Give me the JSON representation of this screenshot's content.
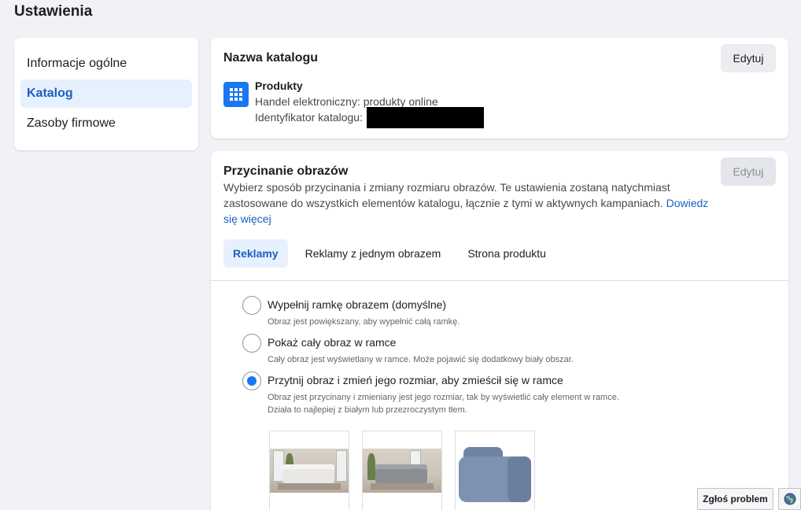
{
  "page": {
    "title": "Ustawienia"
  },
  "sidebar": {
    "items": [
      {
        "label": "Informacje ogólne"
      },
      {
        "label": "Katalog"
      },
      {
        "label": "Zasoby firmowe"
      }
    ]
  },
  "catalog_card": {
    "title": "Nazwa katalogu",
    "edit_label": "Edytuj",
    "catalog_name": "Produkty",
    "catalog_type": "Handel elektroniczny: produkty online",
    "catalog_id_label": "Identyfikator katalogu:"
  },
  "crop_card": {
    "title": "Przycinanie obrazów",
    "edit_label": "Edytuj",
    "description": "Wybierz sposób przycinania i zmiany rozmiaru obrazów. Te ustawienia zostaną natychmiast zastosowane do wszystkich elementów katalogu, łącznie z tymi w aktywnych kampaniach.",
    "learn_more": "Dowiedz się więcej",
    "tabs": [
      {
        "label": "Reklamy"
      },
      {
        "label": "Reklamy z jednym obrazem"
      },
      {
        "label": "Strona produktu"
      }
    ],
    "options": [
      {
        "label": "Wypełnij ramkę obrazem (domyślne)",
        "description": "Obraz jest powiększany, aby wypełnić całą ramkę."
      },
      {
        "label": "Pokaż cały obraz w ramce",
        "description": "Cały obraz jest wyświetlany w ramce. Może pojawić się dodatkowy biały obszar."
      },
      {
        "label": "Przytnij obraz i zmień jego rozmiar, aby zmieścił się w ramce",
        "description": "Obraz jest przycinany i zmieniany jest jego rozmiar, tak by wyświetlić cały element w ramce. Działa to najlepiej z białym lub przezroczystym tłem."
      }
    ],
    "selected_option": 2
  },
  "footer": {
    "report_label": "Zgłoś problem"
  },
  "colors": {
    "accent": "#1877f2",
    "active_text": "#1b5fc1",
    "active_bg": "#e7f0fd"
  }
}
